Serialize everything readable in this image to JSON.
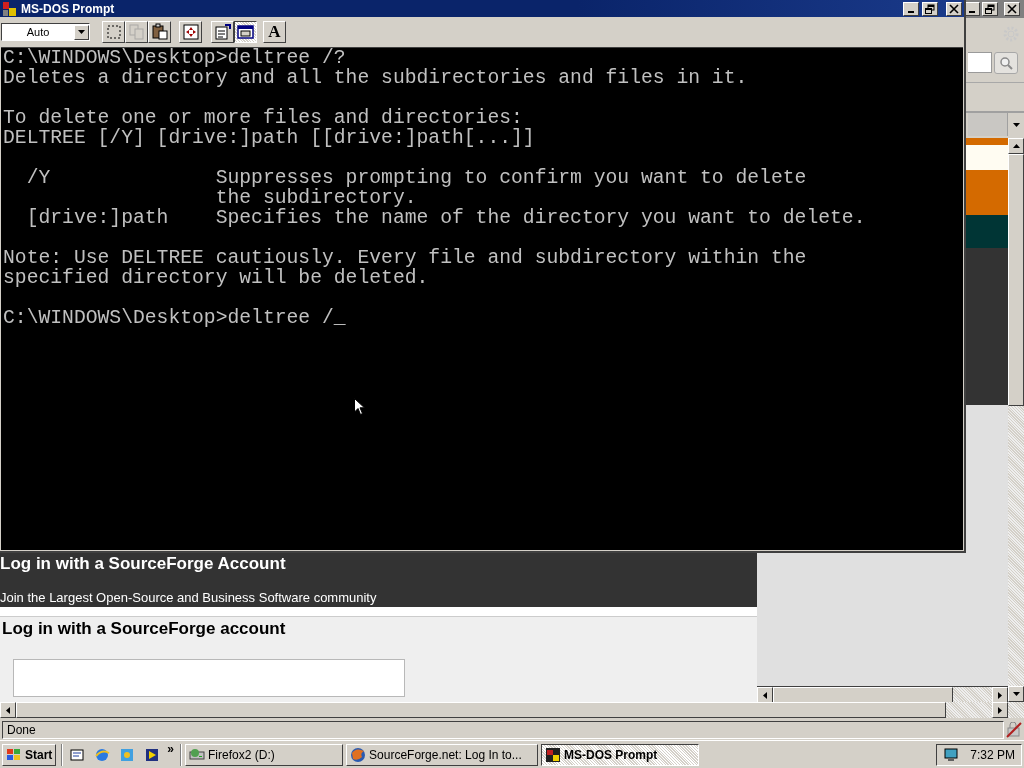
{
  "browser": {
    "page": {
      "banner_title": "Log in with a SourceForge Account",
      "banner_subtitle": "Join the Largest Open-Source and Business Software community",
      "form_title": "Log in with a SourceForge account"
    },
    "status_bar": "Done"
  },
  "dos_window": {
    "title": "MS-DOS Prompt",
    "font_size": "Auto",
    "toolbar": [
      {
        "kind": "mark",
        "pressed": false,
        "disabled": false
      },
      {
        "kind": "copy",
        "pressed": false,
        "disabled": true
      },
      {
        "kind": "paste",
        "pressed": false,
        "disabled": false
      },
      {
        "kind": "fullscreen",
        "pressed": false,
        "disabled": false
      },
      {
        "kind": "properties",
        "pressed": false,
        "disabled": false
      },
      {
        "kind": "background",
        "pressed": true,
        "disabled": false
      },
      {
        "kind": "font",
        "label": "A",
        "pressed": false,
        "disabled": false
      }
    ],
    "console_blocks": [
      [
        "C:\\WINDOWS\\Desktop>deltree /?",
        "Deletes a directory and all the subdirectories and files in it."
      ],
      [
        "To delete one or more files and directories:",
        "DELTREE [/Y] [drive:]path [[drive:]path[...]]"
      ],
      [
        "  /Y              Suppresses prompting to confirm you want to delete",
        "                  the subdirectory.",
        "  [drive:]path    Specifies the name of the directory you want to delete."
      ],
      [
        "Note: Use DELTREE cautiously. Every file and subdirectory within the",
        "specified directory will be deleted."
      ],
      [
        "C:\\WINDOWS\\Desktop>deltree /_"
      ]
    ]
  },
  "taskbar": {
    "start": "Start",
    "more": "»",
    "tasks": [
      {
        "kind": "drive",
        "label": "Firefox2 (D:)",
        "selected": false
      },
      {
        "kind": "browser",
        "label": "SourceForge.net: Log In to...",
        "selected": false
      },
      {
        "kind": "dos",
        "label": "MS-DOS Prompt",
        "selected": true
      }
    ],
    "clock": "7:32 PM"
  }
}
